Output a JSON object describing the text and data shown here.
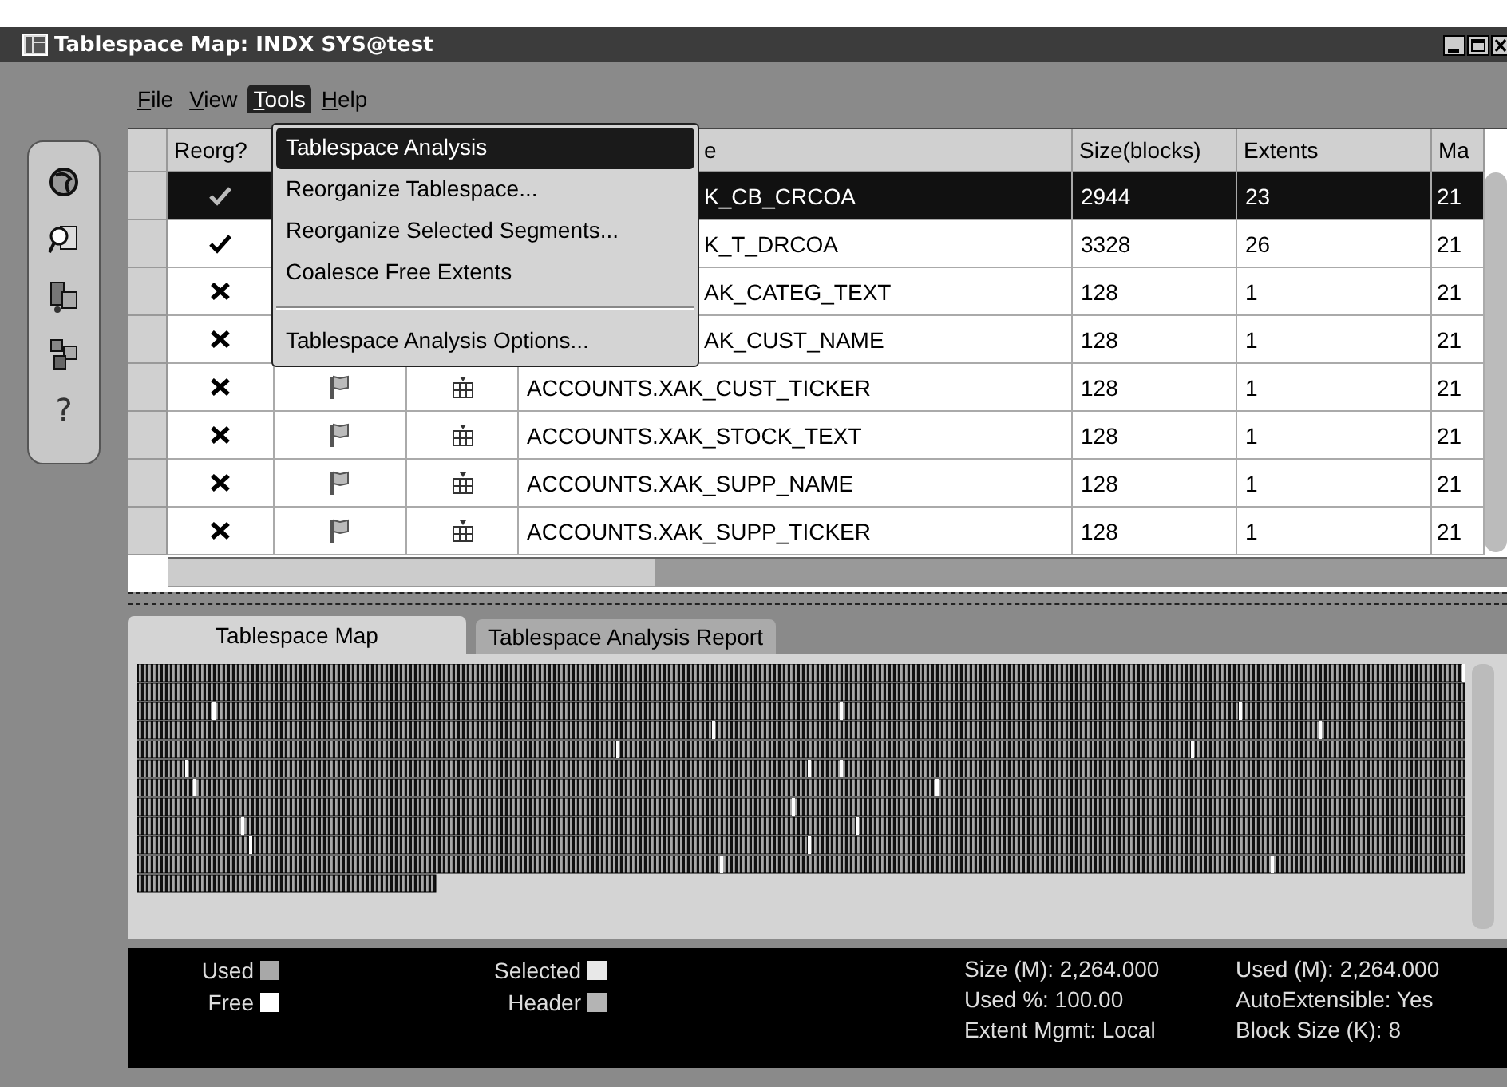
{
  "window": {
    "title": "Tablespace Map: INDX SYS@test"
  },
  "menu": [
    {
      "label": "File",
      "selected": false
    },
    {
      "label": "View",
      "selected": false
    },
    {
      "label": "Tools",
      "selected": true
    },
    {
      "label": "Help",
      "selected": false
    }
  ],
  "dropdown": [
    {
      "label": "Tablespace Analysis",
      "selected": true,
      "separator_before": false
    },
    {
      "label": "Reorganize Tablespace...",
      "selected": false,
      "separator_before": false
    },
    {
      "label": "Reorganize Selected Segments...",
      "selected": false,
      "separator_before": false
    },
    {
      "label": "Coalesce Free Extents",
      "selected": false,
      "separator_before": false
    },
    {
      "label": "Tablespace Analysis Options...",
      "selected": false,
      "separator_before": true
    }
  ],
  "toolbar": [
    {
      "kind": "icon"
    },
    {
      "kind": "icon"
    },
    {
      "kind": "icon"
    },
    {
      "kind": "icon"
    },
    {
      "kind": "text",
      "label": "?"
    }
  ],
  "table": {
    "columns": [
      "Reorg?",
      "e",
      "Size(blocks)",
      "Extents",
      "Ma"
    ],
    "rows": [
      {
        "selected": true,
        "reorg": true,
        "name": "K_CB_CRCOA",
        "size": "2944",
        "extents": "23",
        "column_8": "21"
      },
      {
        "selected": false,
        "reorg": true,
        "name": "K_T_DRCOA",
        "size": "3328",
        "extents": "26",
        "column_8": "21"
      },
      {
        "selected": false,
        "reorg": false,
        "name": "AK_CATEG_TEXT",
        "size": "128",
        "extents": "1",
        "column_8": "21"
      },
      {
        "selected": false,
        "reorg": false,
        "name": "AK_CUST_NAME",
        "size": "128",
        "extents": "1",
        "column_8": "21"
      },
      {
        "selected": false,
        "reorg": false,
        "name": "ACCOUNTS.XAK_CUST_TICKER",
        "size": "128",
        "extents": "1",
        "column_8": "21"
      },
      {
        "selected": false,
        "reorg": false,
        "name": "ACCOUNTS.XAK_STOCK_TEXT",
        "size": "128",
        "extents": "1",
        "column_8": "21"
      },
      {
        "selected": false,
        "reorg": false,
        "name": "ACCOUNTS.XAK_SUPP_NAME",
        "size": "128",
        "extents": "1",
        "column_8": "21"
      },
      {
        "selected": false,
        "reorg": false,
        "name": "ACCOUNTS.XAK_SUPP_TICKER",
        "size": "128",
        "extents": "1",
        "column_8": "21"
      }
    ]
  },
  "tabs": [
    {
      "label": "Tablespace Map",
      "selected": true
    },
    {
      "label": "Tablespace Analysis Report",
      "selected": false
    }
  ],
  "legend": [
    {
      "label": "Used",
      "color": "#a8a8a8"
    },
    {
      "label": "Selected",
      "color": "#e8e8e8"
    },
    {
      "label": "Free",
      "color": "#ffffff"
    },
    {
      "label": "Header",
      "color": "#b4b4b4"
    }
  ],
  "stats": [
    "Size (M): 2,264.000",
    "Used (M): 2,264.000",
    "Used %: 100.00",
    "AutoExtensible: Yes",
    "Extent Mgmt: Local",
    "Block Size (K): 8"
  ]
}
